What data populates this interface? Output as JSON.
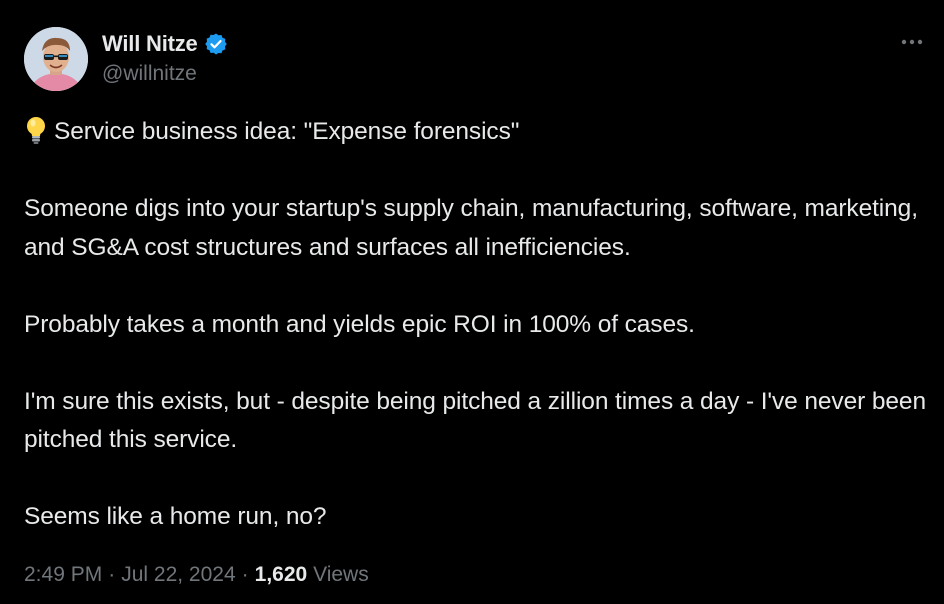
{
  "author": {
    "display_name": "Will Nitze",
    "handle": "@willnitze",
    "verified": true,
    "avatar_icon": "profile-photo-with-sunglasses",
    "verified_icon": "verified-badge-icon"
  },
  "colors": {
    "background": "#000000",
    "primary_text": "#e7e9ea",
    "secondary_text": "#71767b",
    "verified_blue": "#1d9bf0"
  },
  "tweet": {
    "emoji_icon": "lightbulb-icon",
    "first_line": "Service business idea: \"Expense forensics\"",
    "paragraph_2": "Someone digs into your startup's supply chain, manufacturing, software, marketing, and SG&A cost structures and surfaces all inefficiencies.",
    "paragraph_3": "Probably takes a month and yields epic ROI in 100% of cases.",
    "paragraph_4": "I'm sure this exists, but - despite being pitched a zillion times a day - I've never been pitched this service.",
    "paragraph_5": "Seems like a home run, no?"
  },
  "meta": {
    "time": "2:49 PM",
    "separator_1": "·",
    "date": "Jul 22, 2024",
    "separator_2": "·",
    "views_count": "1,620",
    "views_label": "Views"
  },
  "more_icon": "more-horizontal-icon"
}
